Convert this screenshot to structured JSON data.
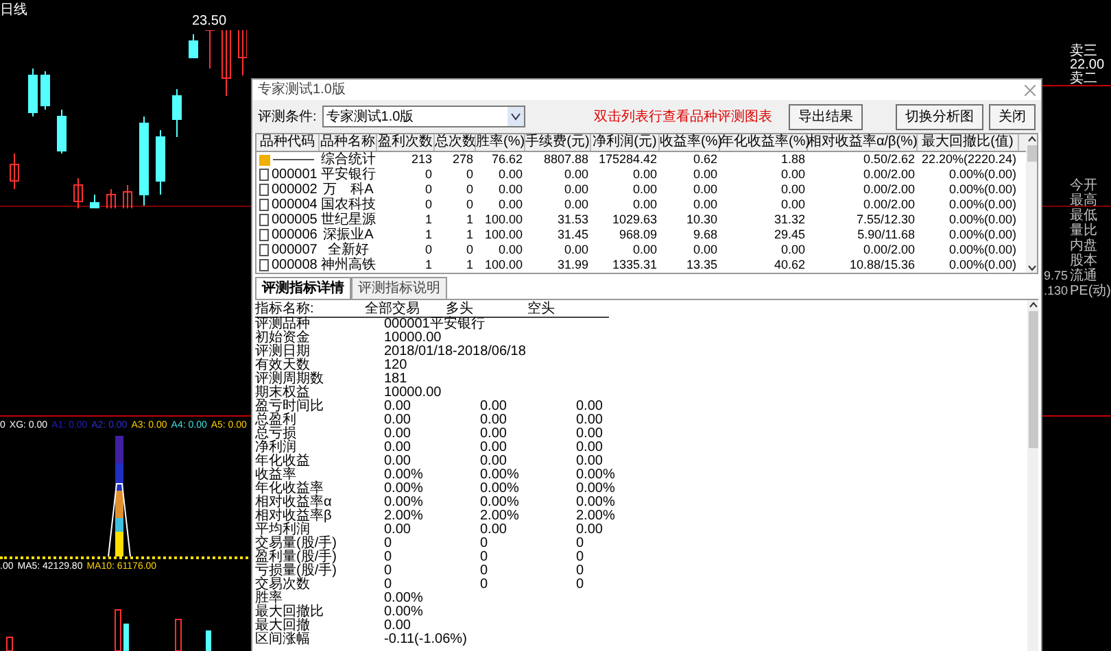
{
  "chart": {
    "period_label": "日线",
    "high_label": "23.50",
    "indicator_values": [
      {
        "text": "0",
        "color": "#ffffff"
      },
      {
        "text": "XG: 0.00",
        "color": "#ffffff"
      },
      {
        "text": "A1: 0.00",
        "color": "#2020c0"
      },
      {
        "text": "A2: 0.00",
        "color": "#3030d0"
      },
      {
        "text": "A3: 0.00",
        "color": "#ffd000"
      },
      {
        "text": "A4: 0.00",
        "color": "#40e0e0"
      },
      {
        "text": "A5: 0.00",
        "color": "#ffd000"
      }
    ],
    "volume_values": [
      {
        "text": ".00",
        "color": "#ffffff"
      },
      {
        "text": "MA5: 42129.80",
        "color": "#ffffff"
      },
      {
        "text": "MA10: 61176.00",
        "color": "#ffd000"
      }
    ],
    "order_book": [
      "卖三",
      "22.00",
      "卖二"
    ],
    "quote_labels": [
      "今开",
      "最高",
      "最低",
      "量比",
      "内盘",
      "股本",
      "流通",
      "PE(动)"
    ],
    "quote_values": [
      "9.75",
      ".130"
    ]
  },
  "dialog": {
    "title": "专家测试1.0版",
    "condition_label": "评测条件:",
    "condition_value": "专家测试1.0版",
    "hint": "双击列表行查看品种评测图表",
    "buttons": [
      "导出结果",
      "切换分析图",
      "关闭"
    ],
    "columns": [
      "品种代码",
      "品种名称",
      "盈利次数",
      "总次数",
      "胜率(%)",
      "手续费(元)",
      "净利润(元)",
      "收益率(%)",
      "年化收益率(%)",
      "相对收益率α/β(%)",
      "最大回撤比(值)"
    ],
    "rows": [
      {
        "kind": "summary",
        "cells": [
          "———",
          "综合统计",
          "213",
          "278",
          "76.62",
          "8807.88",
          "175284.42",
          "0.62",
          "1.88",
          "0.50/2.62",
          "22.20%(2220.24)"
        ]
      },
      {
        "kind": "stock",
        "cells": [
          "000001",
          "平安银行",
          "0",
          "0",
          "0.00",
          "0.00",
          "0.00",
          "0.00",
          "0.00",
          "0.00/2.00",
          "0.00%(0.00)"
        ]
      },
      {
        "kind": "stock",
        "cells": [
          "000002",
          "万　科A",
          "0",
          "0",
          "0.00",
          "0.00",
          "0.00",
          "0.00",
          "0.00",
          "0.00/2.00",
          "0.00%(0.00)"
        ]
      },
      {
        "kind": "stock",
        "cells": [
          "000004",
          "国农科技",
          "0",
          "0",
          "0.00",
          "0.00",
          "0.00",
          "0.00",
          "0.00",
          "0.00/2.00",
          "0.00%(0.00)"
        ]
      },
      {
        "kind": "stock",
        "cells": [
          "000005",
          "世纪星源",
          "1",
          "1",
          "100.00",
          "31.53",
          "1029.63",
          "10.30",
          "31.32",
          "7.55/12.30",
          "0.00%(0.00)"
        ]
      },
      {
        "kind": "stock",
        "cells": [
          "000006",
          "深振业A",
          "1",
          "1",
          "100.00",
          "31.45",
          "968.09",
          "9.68",
          "29.45",
          "5.90/11.68",
          "0.00%(0.00)"
        ]
      },
      {
        "kind": "stock",
        "cells": [
          "000007",
          "全新好",
          "0",
          "0",
          "0.00",
          "0.00",
          "0.00",
          "0.00",
          "0.00",
          "0.00/2.00",
          "0.00%(0.00)"
        ]
      },
      {
        "kind": "stock",
        "cells": [
          "000008",
          "神州高铁",
          "1",
          "1",
          "100.00",
          "31.99",
          "1335.31",
          "13.35",
          "40.62",
          "10.88/15.36",
          "0.00%(0.00)"
        ]
      }
    ],
    "tabs": [
      {
        "label": "评测指标详情",
        "selected": true
      },
      {
        "label": "评测指标说明",
        "selected": false
      }
    ],
    "detail_columns": [
      "指标名称:",
      "全部交易",
      "多头",
      "空头"
    ],
    "details": [
      {
        "cells": [
          "评测品种",
          "000001平安银行"
        ]
      },
      {
        "cells": [
          "初始资金",
          "10000.00"
        ]
      },
      {
        "cells": [
          "评测日期",
          "2018/01/18-2018/06/18"
        ]
      },
      {
        "cells": [
          "有效天数",
          "120"
        ]
      },
      {
        "cells": [
          "评测周期数",
          "181"
        ]
      },
      {
        "cells": [
          "期末权益",
          "10000.00"
        ]
      },
      {
        "cells": [
          "盈亏时间比",
          "0.00",
          "0.00",
          "0.00"
        ]
      },
      {
        "cells": [
          "总盈利",
          "0.00",
          "0.00",
          "0.00"
        ]
      },
      {
        "cells": [
          "总亏损",
          "0.00",
          "0.00",
          "0.00"
        ]
      },
      {
        "cells": [
          "净利润",
          "0.00",
          "0.00",
          "0.00"
        ]
      },
      {
        "cells": [
          "年化收益",
          "0.00",
          "0.00",
          "0.00"
        ]
      },
      {
        "cells": [
          "收益率",
          "0.00%",
          "0.00%",
          "0.00%"
        ]
      },
      {
        "cells": [
          "年化收益率",
          "0.00%",
          "0.00%",
          "0.00%"
        ]
      },
      {
        "cells": [
          "相对收益率α",
          "0.00%",
          "0.00%",
          "0.00%"
        ]
      },
      {
        "cells": [
          "相对收益率β",
          "2.00%",
          "2.00%",
          "2.00%"
        ]
      },
      {
        "cells": [
          "平均利润",
          "0.00",
          "0.00",
          "0.00"
        ]
      },
      {
        "cells": [
          "交易量(股/手)",
          "0",
          "0",
          "0"
        ]
      },
      {
        "cells": [
          "盈利量(股/手)",
          "0",
          "0",
          "0"
        ]
      },
      {
        "cells": [
          "亏损量(股/手)",
          "0",
          "0",
          "0"
        ]
      },
      {
        "cells": [
          "交易次数",
          "0",
          "0",
          "0"
        ]
      },
      {
        "cells": [
          "胜率",
          "0.00%"
        ]
      },
      {
        "cells": [
          "最大回撤比",
          "0.00%"
        ]
      },
      {
        "cells": [
          "最大回撤",
          "0.00"
        ]
      },
      {
        "cells": [
          "区间涨幅",
          "-0.11(-1.06%)"
        ]
      }
    ]
  }
}
